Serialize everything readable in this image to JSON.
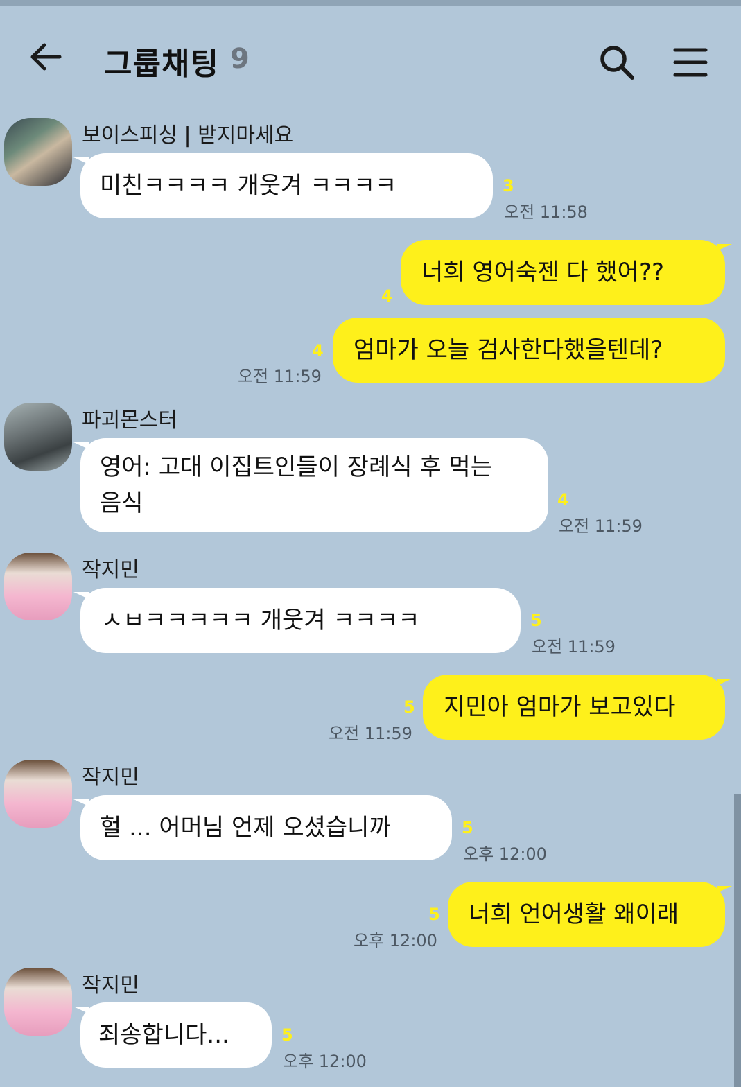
{
  "header": {
    "title": "그룹채팅",
    "member_count": "9",
    "icons": {
      "back": "back-arrow-icon",
      "search": "search-icon",
      "menu": "hamburger-menu-icon"
    }
  },
  "colors": {
    "background": "#b2c7d9",
    "my_bubble": "#fef01b",
    "their_bubble": "#ffffff",
    "unread": "#fef01b"
  },
  "messages": [
    {
      "sender": "보이스피싱 | 받지마세요",
      "text": "미친ㅋㅋㅋㅋ 개웃겨 ㅋㅋㅋㅋ",
      "unread": "3",
      "time": "오전 11:58",
      "mine": false
    },
    {
      "text": "너희 영어숙젠 다 했어??",
      "unread": "4",
      "mine": true
    },
    {
      "text": "엄마가 오늘 검사한다했을텐데?",
      "unread": "4",
      "time": "오전 11:59",
      "mine": true
    },
    {
      "sender": "파괴몬스터",
      "text": "영어: 고대 이집트인들이 장례식 후 먹는 음식",
      "unread": "4",
      "time": "오전 11:59",
      "mine": false
    },
    {
      "sender": "작지민",
      "text": "ㅅㅂㅋㅋㅋㅋㅋ 개웃겨 ㅋㅋㅋㅋ",
      "unread": "5",
      "time": "오전 11:59",
      "mine": false
    },
    {
      "text": "지민아 엄마가 보고있다",
      "unread": "5",
      "time": "오전 11:59",
      "mine": true
    },
    {
      "sender": "작지민",
      "text": "헐 ... 어머님 언제 오셨습니까",
      "unread": "5",
      "time": "오후 12:00",
      "mine": false
    },
    {
      "text": "너희 언어생활 왜이래",
      "unread": "5",
      "time": "오후 12:00",
      "mine": true
    },
    {
      "sender": "작지민",
      "text": "죄송합니다...",
      "unread": "5",
      "time": "오후 12:00",
      "mine": false
    }
  ]
}
